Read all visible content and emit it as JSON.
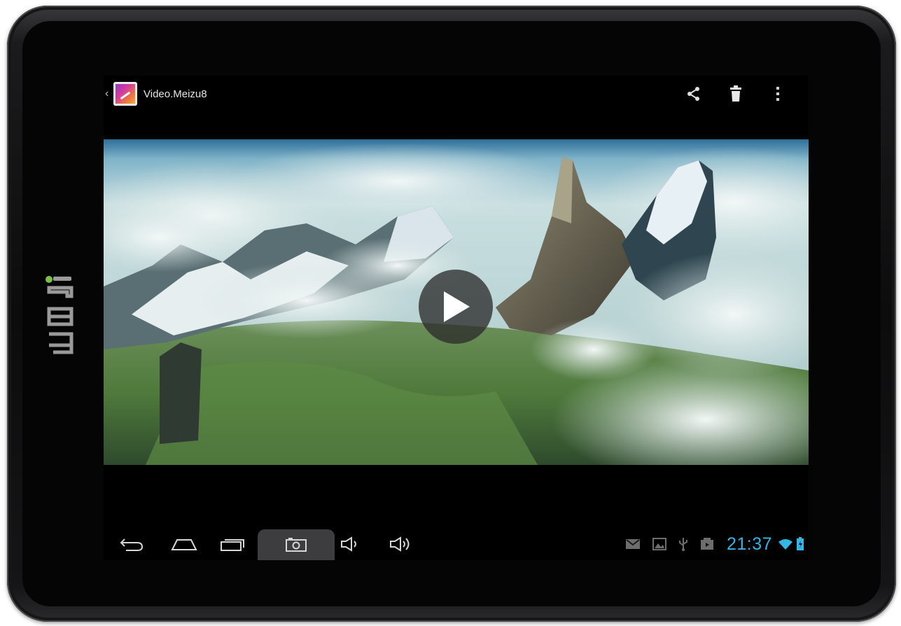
{
  "device": {
    "brand_logo_icon": "inar-logo-icon"
  },
  "action_bar": {
    "up_icon": "chevron-left-icon",
    "app_icon": "gallery-icon",
    "title": "Video.Meizu8",
    "actions": [
      {
        "name": "share",
        "icon": "share-icon"
      },
      {
        "name": "delete",
        "icon": "trash-icon"
      },
      {
        "name": "overflow",
        "icon": "more-vert-icon"
      }
    ]
  },
  "video": {
    "thumbnail": "aerial-mountains-clouds",
    "play_icon": "play-icon"
  },
  "navigation_bar": {
    "buttons": [
      {
        "name": "back",
        "icon": "back-arrow-icon"
      },
      {
        "name": "home",
        "icon": "home-icon"
      },
      {
        "name": "recent-apps",
        "icon": "recent-apps-icon"
      },
      {
        "name": "screenshot",
        "icon": "camera-icon"
      },
      {
        "name": "volume-down",
        "icon": "volume-down-icon"
      },
      {
        "name": "volume-up",
        "icon": "volume-up-icon"
      }
    ]
  },
  "status_bar": {
    "notification_icons": [
      "gmail-icon",
      "gallery-notification-icon",
      "usb-icon",
      "media-icon"
    ],
    "time": "21:37",
    "wifi_icon": "wifi-icon",
    "battery_icon": "battery-icon",
    "accent_color": "#33b5e5"
  }
}
